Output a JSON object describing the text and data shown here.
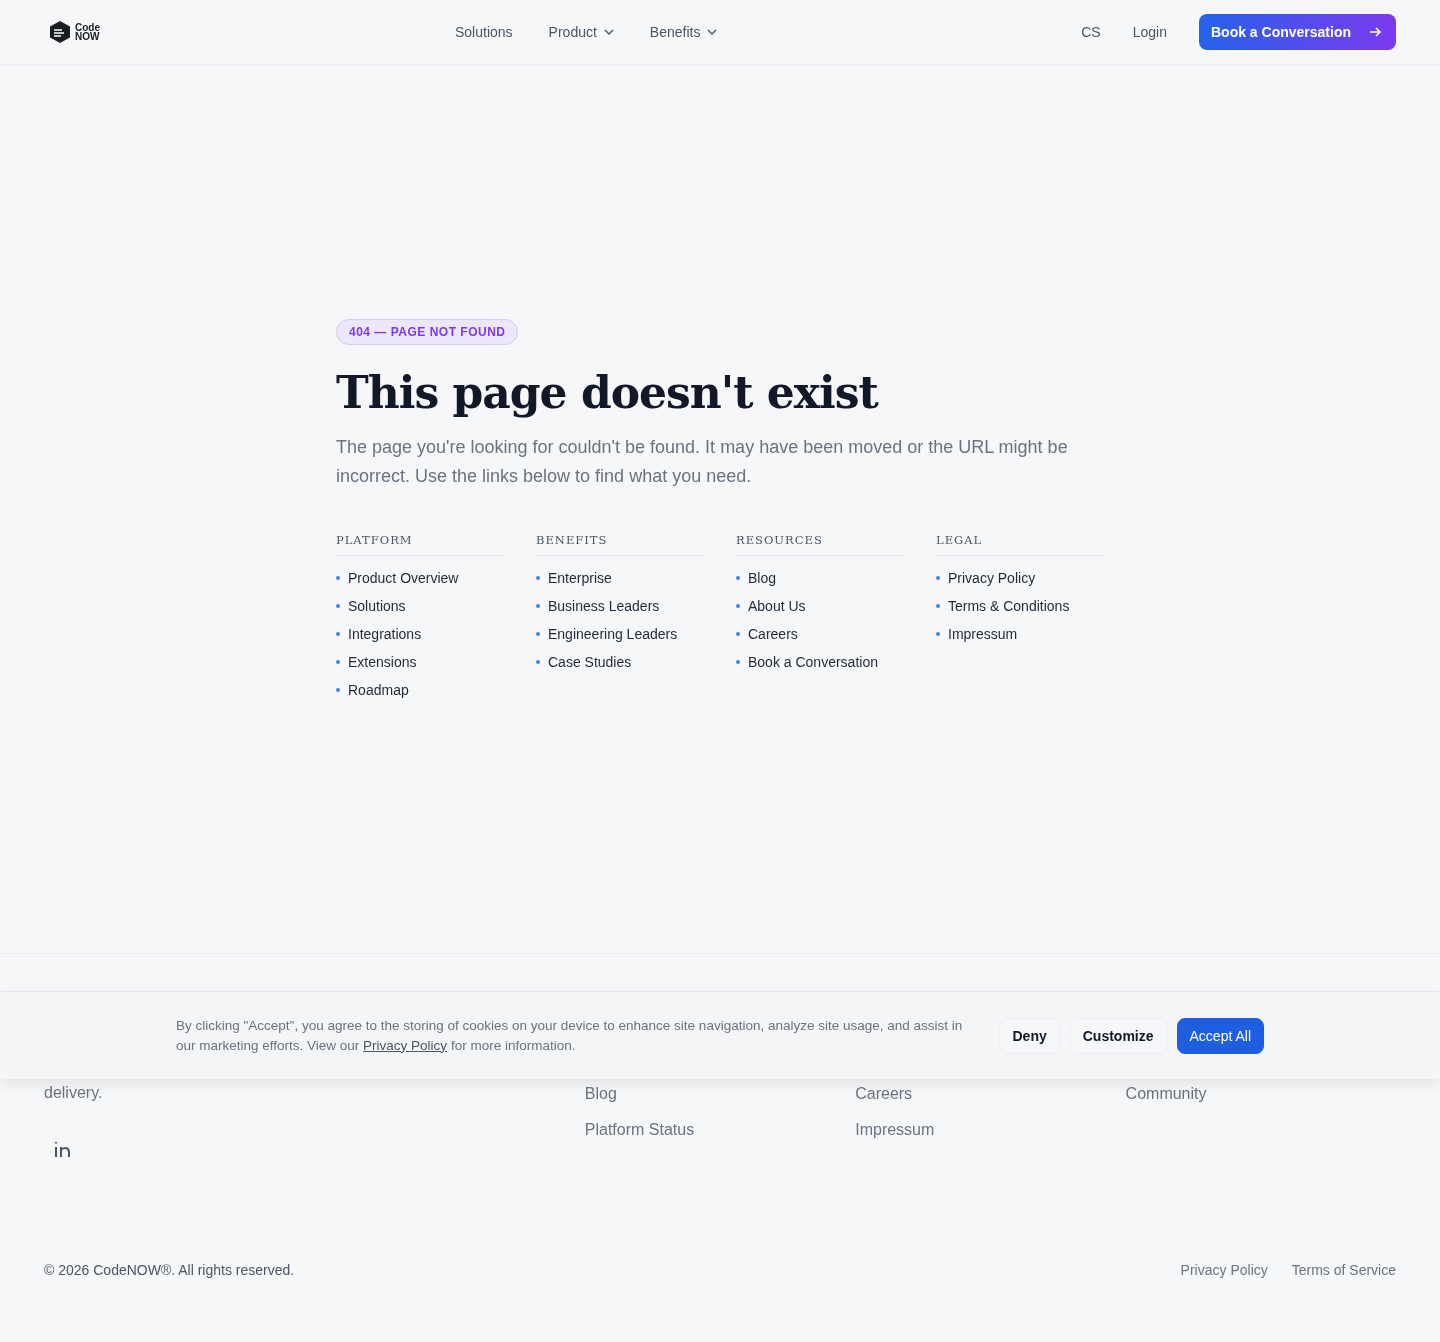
{
  "header": {
    "logo": {
      "line1": "Code",
      "line2": "NOW"
    },
    "nav": [
      {
        "label": "Solutions",
        "dropdown": false
      },
      {
        "label": "Product",
        "dropdown": true
      },
      {
        "label": "Benefits",
        "dropdown": true
      }
    ],
    "language": "CS",
    "login": "Login",
    "cta": "Book a Conversation"
  },
  "hero": {
    "badge": "404 — PAGE NOT FOUND",
    "title": "This page doesn't exist",
    "text": "The page you're looking for couldn't be found. It may have been moved or the URL might be incorrect. Use the links below to find what you need."
  },
  "link_groups": [
    {
      "heading": "PLATFORM",
      "links": [
        "Product Overview",
        "Solutions",
        "Integrations",
        "Extensions",
        "Roadmap"
      ]
    },
    {
      "heading": "BENEFITS",
      "links": [
        "Enterprise",
        "Business Leaders",
        "Engineering Leaders",
        "Case Studies"
      ]
    },
    {
      "heading": "RESOURCES",
      "links": [
        "Blog",
        "About Us",
        "Careers",
        "Book a Conversation"
      ]
    },
    {
      "heading": "LEGAL",
      "links": [
        "Privacy Policy",
        "Terms & Conditions",
        "Impressum"
      ]
    }
  ],
  "cookie_banner": {
    "text_before": "By clicking \"Accept\", you agree to the storing of cookies on your device to enhance site navigation, analyze site usage, and assist in our marketing efforts. View our",
    "link": "Privacy Policy",
    "text_after": "for more information.",
    "buttons": [
      {
        "label": "Deny",
        "kind": "plain"
      },
      {
        "label": "Customize",
        "kind": "plain"
      },
      {
        "label": "Accept All",
        "kind": "primary"
      }
    ]
  },
  "footer": {
    "tagline": "delivery.",
    "columns": [
      [
        "Blog",
        "Platform Status"
      ],
      [
        "Careers",
        "Impressum"
      ],
      [
        "Community"
      ]
    ],
    "copyright": "© 2026 CodeNOW®. All rights reserved.",
    "legal_links": [
      "Privacy Policy",
      "Terms of Service"
    ]
  }
}
